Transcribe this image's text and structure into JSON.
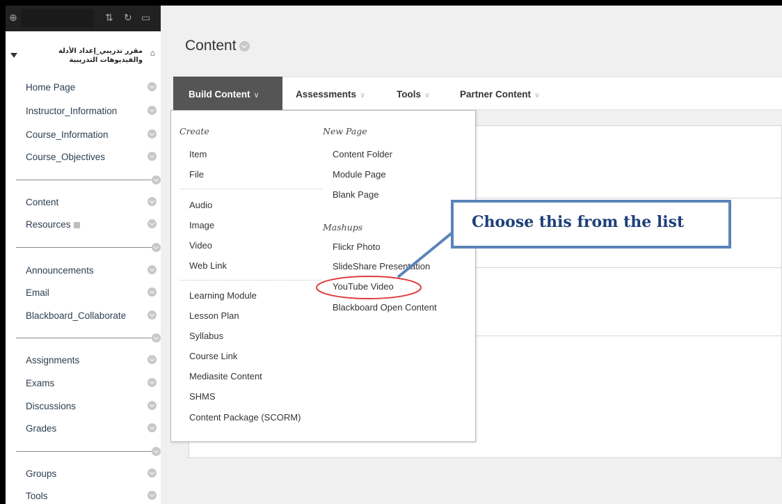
{
  "sidebar": {
    "top_icons": [
      "plus-circle-icon",
      "sort-icon",
      "refresh-icon",
      "folder-icon"
    ],
    "course_title": "مقرر تدريبي_إعداد الأدلة والفيديوهات التدريبية",
    "items": [
      {
        "label": "Home Page"
      },
      {
        "label": "Instructor_Information"
      },
      {
        "label": "Course_Information"
      },
      {
        "label": "Course_Objectives"
      },
      {
        "label": "Content"
      },
      {
        "label": "Resources"
      },
      {
        "label": "Announcements"
      },
      {
        "label": "Email"
      },
      {
        "label": "Blackboard_Collaborate"
      },
      {
        "label": "Assignments"
      },
      {
        "label": "Exams"
      },
      {
        "label": "Discussions"
      },
      {
        "label": "Grades"
      },
      {
        "label": "Groups"
      },
      {
        "label": "Tools"
      }
    ]
  },
  "page": {
    "title": "Content"
  },
  "action_bar": {
    "build_content": "Build Content",
    "assessments": "Assessments",
    "tools": "Tools",
    "partner_content": "Partner Content",
    "chevron": "∨"
  },
  "dropdown": {
    "create_heading": "Create",
    "create_items": [
      "Item",
      "File",
      "Audio",
      "Image",
      "Video",
      "Web Link",
      "Learning Module",
      "Lesson Plan",
      "Syllabus",
      "Course Link",
      "Mediasite Content",
      "SHMS",
      "Content Package (SCORM)"
    ],
    "new_page_heading": "New Page",
    "new_page_items": [
      "Content Folder",
      "Module Page",
      "Blank Page"
    ],
    "mashups_heading": "Mashups",
    "mashups_items": [
      "Flickr Photo",
      "SlideShare Presentation",
      "YouTube Video",
      "Blackboard Open Content"
    ]
  },
  "callout": {
    "text": "Choose this from the list"
  },
  "colors": {
    "callout_border": "#5b84b9",
    "callout_text": "#1f3f7a",
    "highlight_ellipse": "#e03c3c",
    "build_content_bg": "#555555",
    "sidebar_top_bg": "#212121"
  }
}
